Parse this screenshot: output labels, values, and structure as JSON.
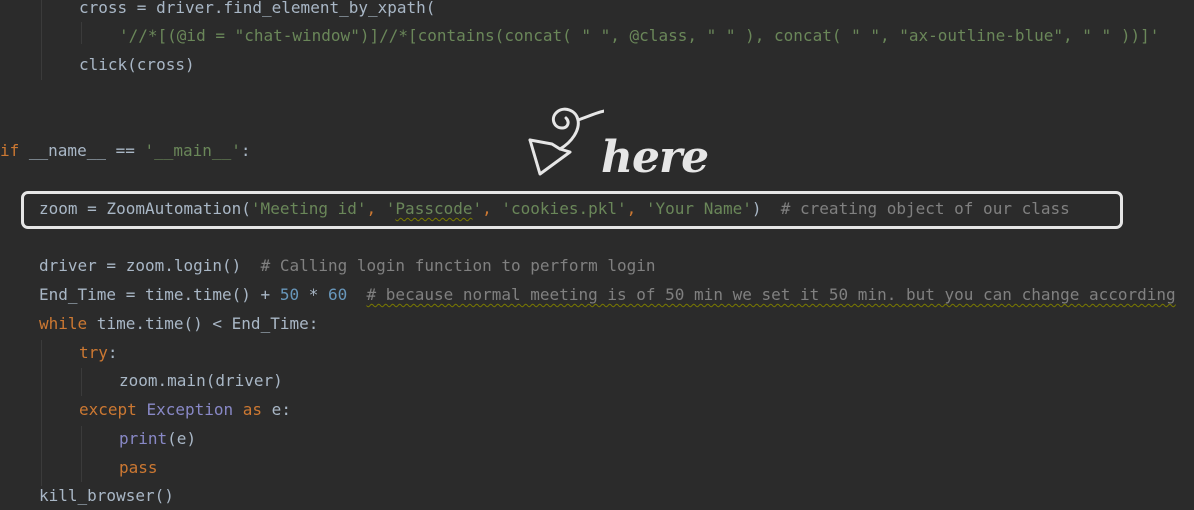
{
  "annotation": {
    "text": "here"
  },
  "colors": {
    "background": "#2b2b2b",
    "keyword": "#cc7832",
    "string": "#6a8759",
    "number": "#6897bb",
    "comment": "#808080",
    "builtin": "#8888c6",
    "default": "#a9b7c6",
    "highlight_border": "#e6e6e6"
  },
  "code": {
    "l1": {
      "a": "cross = driver.find_element_by_xpath("
    },
    "l2": {
      "s": "'//*[(@id = \"chat-window\")]//*[contains(concat( \" \", @class, \" \" ), concat( \" \", \"ax-outline-blue\", \" \" ))]'"
    },
    "l3": {
      "a": "click(cross)"
    },
    "l4": {
      "kw": "if",
      "a": " __name__ == ",
      "s": "'__main__'",
      "b": ":"
    },
    "l5": {
      "a": "zoom = ZoomAutomation(",
      "s1": "'Meeting id'",
      "c1": ", ",
      "s2q1": "'",
      "s2": "Passcode",
      "s2q2": "'",
      "c2": ", ",
      "s3": "'cookies.pkl'",
      "c3": ", ",
      "s4": "'Your Name'",
      "b": ")  ",
      "cm": "# creating object of our class"
    },
    "l6": {
      "a": "driver = zoom.login()  ",
      "cm": "# Calling login function to perform login"
    },
    "l7": {
      "a": "End_Time = time.time() + ",
      "n1": "50",
      "b": " * ",
      "n2": "60",
      "c": "  ",
      "cm": "# because normal meeting is of 50 min we set it 50 min. but you can change according"
    },
    "l8": {
      "kw": "while",
      "a": " time.time() < End_Time:"
    },
    "l9": {
      "kw": "try",
      "a": ":"
    },
    "l10": {
      "a": "zoom.main(driver)"
    },
    "l11": {
      "kw": "except",
      "sp": " ",
      "bi": "Exception",
      "sp2": " ",
      "kw2": "as",
      "a": " e:"
    },
    "l12": {
      "bi": "print",
      "a": "(e)"
    },
    "l13": {
      "kw": "pass"
    },
    "l14": {
      "a": "kill_browser()"
    }
  }
}
